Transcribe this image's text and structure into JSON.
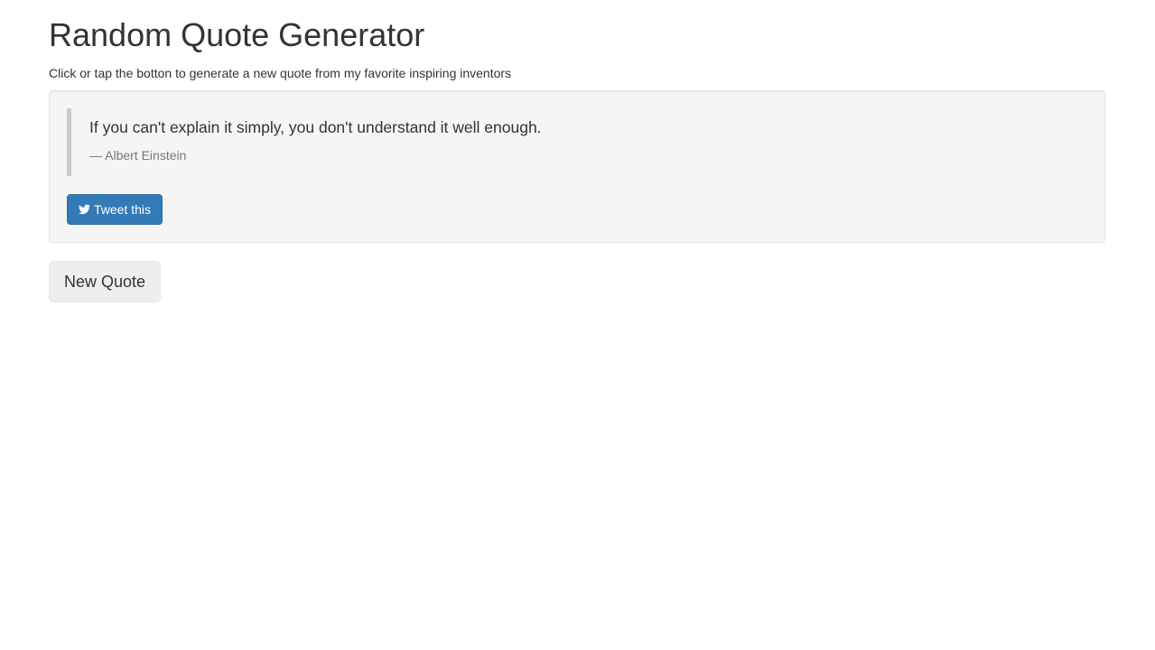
{
  "header": {
    "title": "Random Quote Generator",
    "subtitle": "Click or tap the botton to generate a new quote from my favorite inspiring inventors"
  },
  "quote": {
    "text": "If you can't explain it simply, you don't understand it well enough.",
    "author": "— Albert Einstein"
  },
  "buttons": {
    "tweet_label": "Tweet this",
    "tweet_icon": "twitter-icon",
    "new_quote_label": "New Quote"
  },
  "colors": {
    "primary": "#337ab7",
    "well_background": "#f5f5f5",
    "quote_border": "#cccccc",
    "muted_text": "#777777",
    "default_button": "#eeeeee"
  }
}
